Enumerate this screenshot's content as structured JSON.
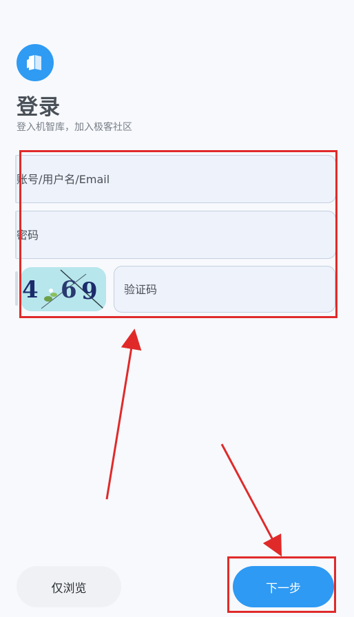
{
  "header": {
    "title": "登录",
    "subtitle": "登入机智库，加入极客社区"
  },
  "form": {
    "account_placeholder": "账号/用户名/Email",
    "password_placeholder": "密码",
    "captcha_placeholder": "验证码",
    "captcha_text": "4 69"
  },
  "actions": {
    "guest_label": "仅浏览",
    "next_label": "下一步"
  },
  "colors": {
    "accent": "#2e9af3",
    "annotation": "#e02a2a",
    "field_bg": "#edf2fb"
  },
  "icons": [
    "logo-icon",
    "captcha-image"
  ]
}
